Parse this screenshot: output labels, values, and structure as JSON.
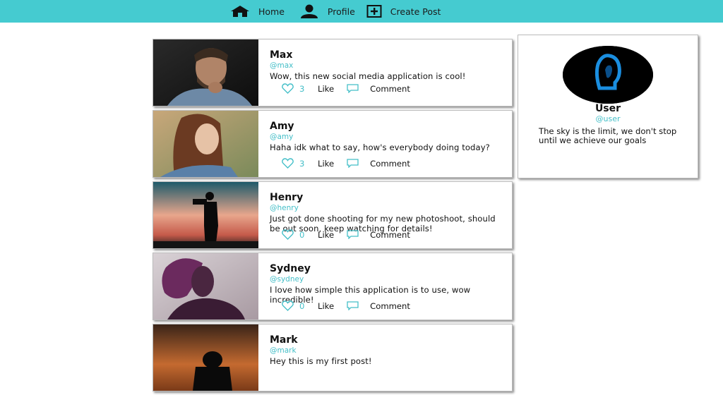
{
  "nav": {
    "home_label": "Home",
    "profile_label": "Profile",
    "create_label": "Create Post",
    "bar_color": "#45cbd0"
  },
  "posts": [
    {
      "name": "Max",
      "handle": "@max",
      "text": "Wow, this new social media application is cool!",
      "likes": "3",
      "like_label": "Like",
      "comment_label": "Comment"
    },
    {
      "name": "Amy",
      "handle": "@amy",
      "text": "Haha idk what to say, how's everybody doing today?",
      "likes": "3",
      "like_label": "Like",
      "comment_label": "Comment"
    },
    {
      "name": "Henry",
      "handle": "@henry",
      "text": "Just got done shooting for my new photoshoot, should be out soon, keep watching for details!",
      "likes": "0",
      "like_label": "Like",
      "comment_label": "Comment"
    },
    {
      "name": "Sydney",
      "handle": "@sydney",
      "text": "I love how simple this application is to use, wow incredible!",
      "likes": "0",
      "like_label": "Like",
      "comment_label": "Comment"
    },
    {
      "name": "Mark",
      "handle": "@mark",
      "text": "Hey this is my first post!",
      "likes": "",
      "like_label": "",
      "comment_label": ""
    }
  ],
  "profile": {
    "name": "User",
    "handle": "@user",
    "bio": "The sky is the limit, we don't stop until we achieve our goals",
    "accent_color": "#45bfc8"
  }
}
